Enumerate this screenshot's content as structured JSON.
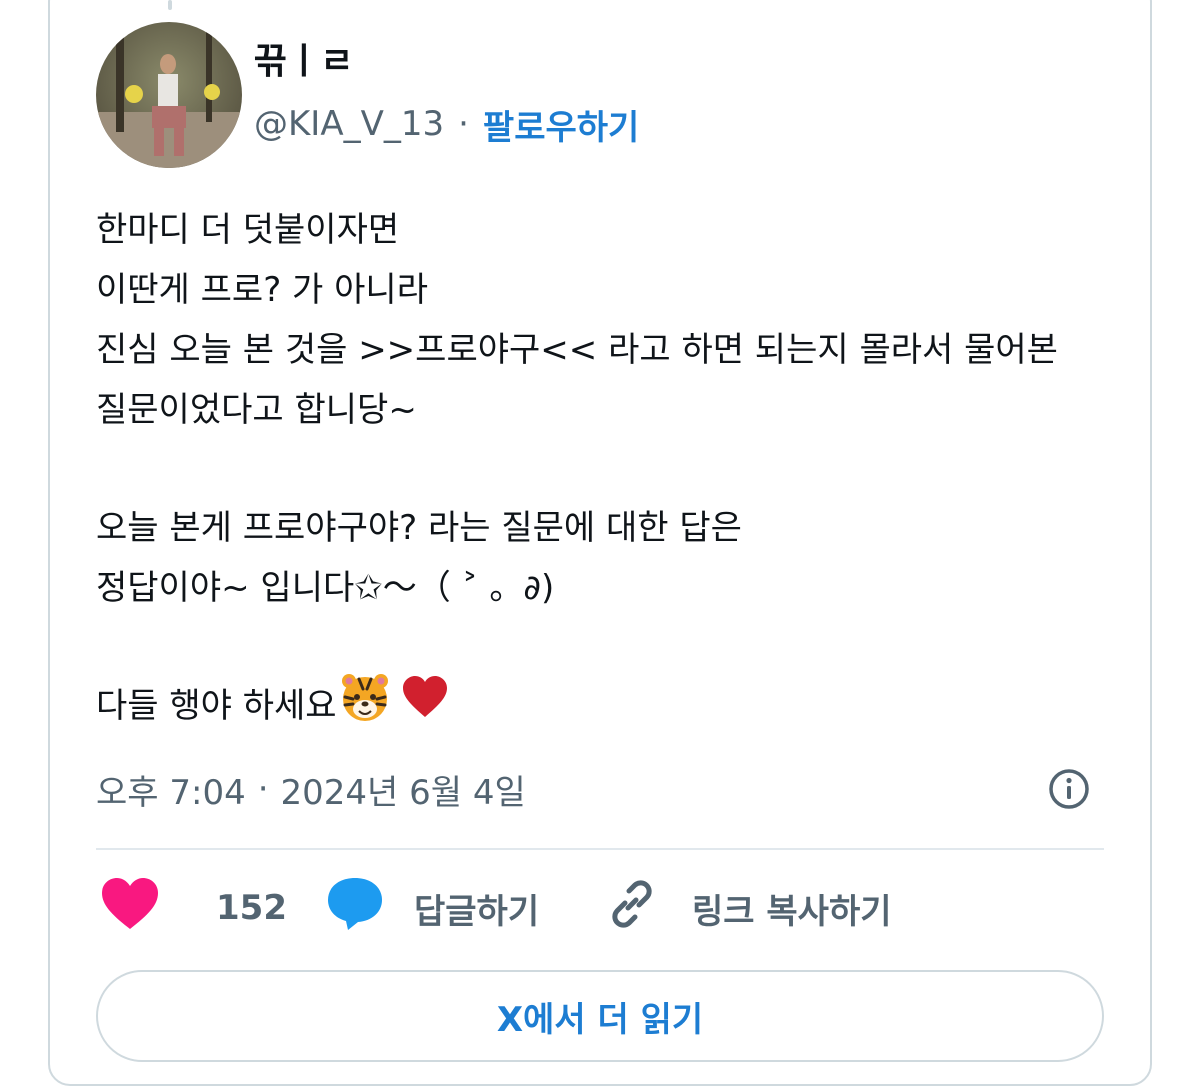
{
  "author": {
    "display_name": "끆ㅣㄹ",
    "handle": "@KIA_V_13",
    "separator": "·",
    "follow_label": "팔로우하기",
    "avatar_icon": "user-avatar-photo"
  },
  "tweet": {
    "lines": [
      "한마디 더 덧붙이자면",
      "이딴게 프로? 가 아니라",
      "진심 오늘 본 것을 >>프로야구<< 라고 하면 되는지 몰라서 물어본",
      "질문이었다고 합니당~",
      "",
      "오늘 본게 프로야구야? 라는 질문에 대한 답은",
      "정답이야~ 입니다✩〜（ ˃ 。∂)",
      "",
      "다들 행야 하세요"
    ],
    "emojis": [
      "tiger-face-emoji",
      "red-heart-emoji"
    ]
  },
  "meta": {
    "time": "오후 7:04",
    "separator": "·",
    "date": "2024년 6월 4일",
    "info_icon": "info-icon"
  },
  "actions": {
    "like_count": "152",
    "reply_label": "답글하기",
    "copy_link_label": "링크 복사하기"
  },
  "read_more_label": "X에서 더 읽기",
  "colors": {
    "accent": "#1d7dd2",
    "like": "#f91880",
    "reply": "#1d9bf0",
    "secondary_text": "#536471",
    "border": "#cfd9de"
  }
}
